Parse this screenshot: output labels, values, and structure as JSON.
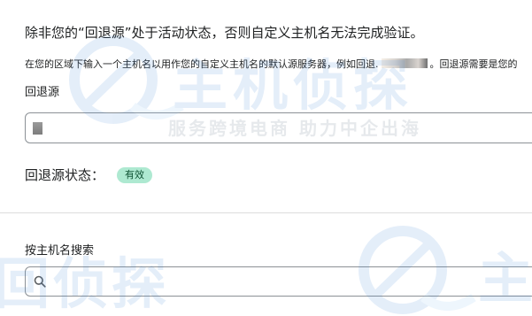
{
  "notice": {
    "text": "除非您的“回退源”处于活动状态，否则自定义主机名无法完成验证。"
  },
  "helper": {
    "text_before": "在您的区域下输入一个主机名以用作您的自定义主机名的默认源服务器，例如回退.",
    "text_after": "。回退源需要是您的"
  },
  "fallback_origin": {
    "label": "回退源",
    "value": ""
  },
  "status": {
    "label": "回退源状态：",
    "badge": "有效",
    "badge_color": "#aee9d1",
    "badge_text_color": "#0d5132"
  },
  "search": {
    "label": "按主机名搜索",
    "value": "",
    "icon": "search-icon"
  },
  "watermark": {
    "brand": "主机侦探",
    "slogan": "服务跨境电商  助力中企出海",
    "partial_top": "主机侦探",
    "partial_bottom_left": "回侦探",
    "partial_bottom_right": "主"
  }
}
